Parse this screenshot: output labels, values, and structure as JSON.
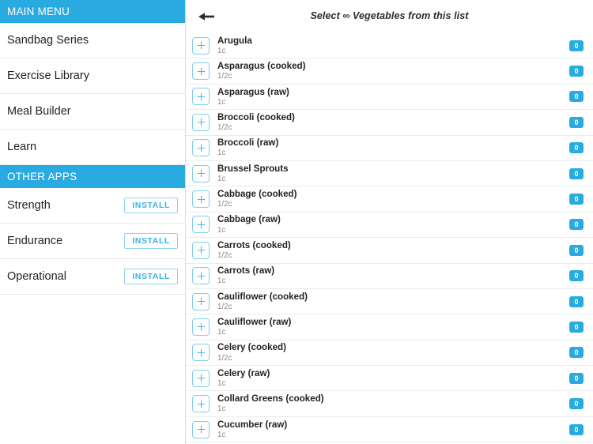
{
  "accent_color": "#29abe2",
  "sidebar": {
    "main_menu": {
      "header": "MAIN MENU",
      "items": [
        {
          "label": "Sandbag Series"
        },
        {
          "label": "Exercise Library"
        },
        {
          "label": "Meal Builder"
        },
        {
          "label": "Learn"
        }
      ]
    },
    "other_apps": {
      "header": "OTHER APPS",
      "items": [
        {
          "label": "Strength",
          "action": "INSTALL"
        },
        {
          "label": "Endurance",
          "action": "INSTALL"
        },
        {
          "label": "Operational",
          "action": "INSTALL"
        }
      ]
    }
  },
  "main": {
    "back_icon": "arrow-left-icon",
    "title": "Select ∞ Vegetables from this list",
    "add_icon": "plus-icon",
    "items": [
      {
        "name": "Arugula",
        "serving": "1c",
        "count": "0"
      },
      {
        "name": "Asparagus (cooked)",
        "serving": "1/2c",
        "count": "0"
      },
      {
        "name": "Asparagus (raw)",
        "serving": "1c",
        "count": "0"
      },
      {
        "name": "Broccoli (cooked)",
        "serving": "1/2c",
        "count": "0"
      },
      {
        "name": "Broccoli (raw)",
        "serving": "1c",
        "count": "0"
      },
      {
        "name": "Brussel Sprouts",
        "serving": "1c",
        "count": "0"
      },
      {
        "name": "Cabbage (cooked)",
        "serving": "1/2c",
        "count": "0"
      },
      {
        "name": "Cabbage (raw)",
        "serving": "1c",
        "count": "0"
      },
      {
        "name": "Carrots (cooked)",
        "serving": "1/2c",
        "count": "0"
      },
      {
        "name": "Carrots (raw)",
        "serving": "1c",
        "count": "0"
      },
      {
        "name": "Cauliflower (cooked)",
        "serving": "1/2c",
        "count": "0"
      },
      {
        "name": "Cauliflower (raw)",
        "serving": "1c",
        "count": "0"
      },
      {
        "name": "Celery (cooked)",
        "serving": "1/2c",
        "count": "0"
      },
      {
        "name": "Celery (raw)",
        "serving": "1c",
        "count": "0"
      },
      {
        "name": "Collard Greens (cooked)",
        "serving": "1c",
        "count": "0"
      },
      {
        "name": "Cucumber (raw)",
        "serving": "1c",
        "count": "0"
      }
    ]
  }
}
